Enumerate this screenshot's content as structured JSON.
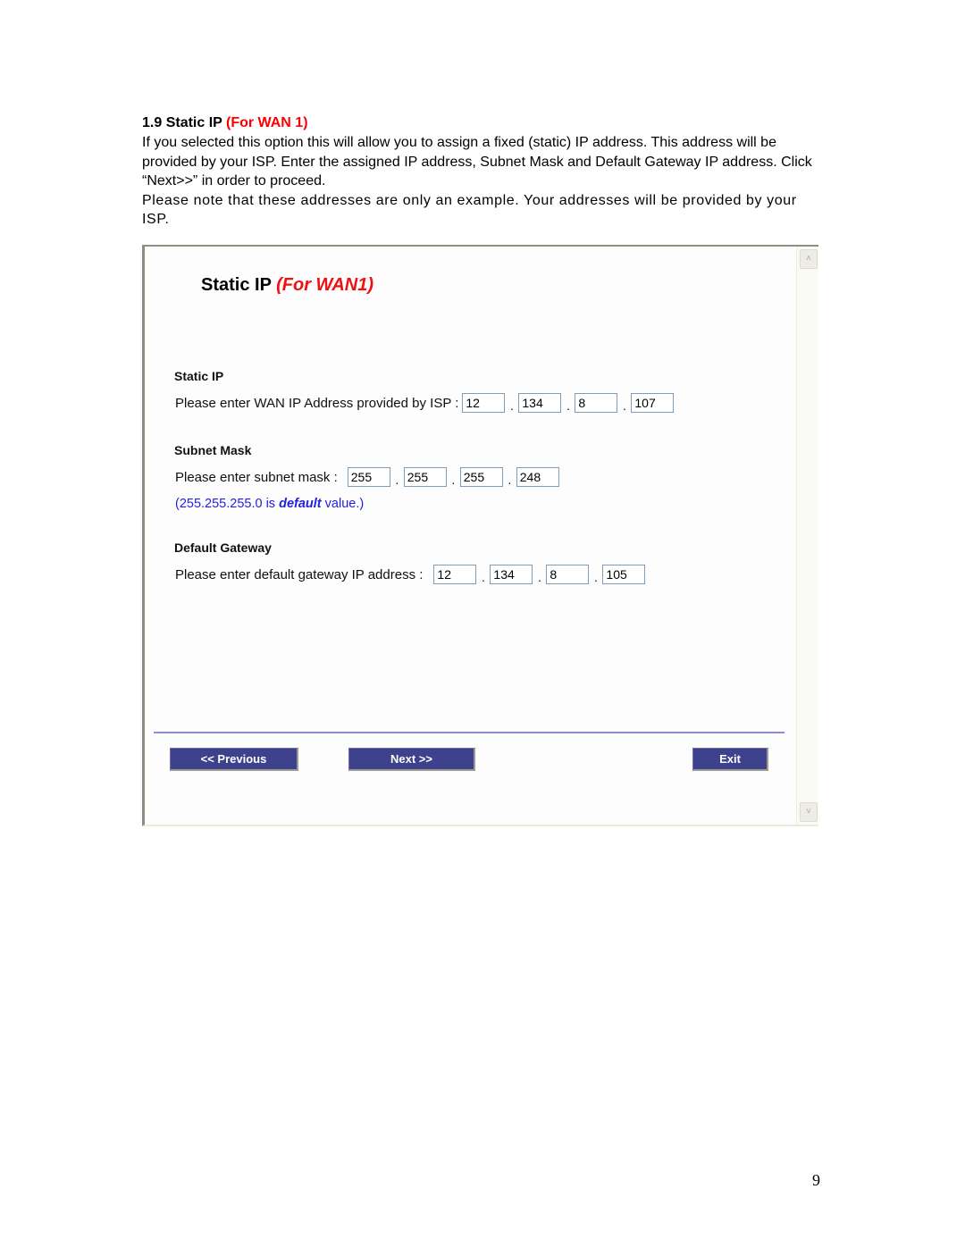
{
  "doc": {
    "heading_prefix": "1.9 Static IP ",
    "heading_highlight": "(For WAN 1)",
    "paragraph_1": "If you selected this option this will allow you to assign a fixed (static) IP address. This address will be provided by your ISP. Enter the assigned IP address, Subnet Mask and Default Gateway IP address. Click “Next>>” in order to proceed.",
    "paragraph_2": "Please note that these addresses are only an example. Your addresses will be provided by your ISP.",
    "page_number": "9"
  },
  "screenshot": {
    "title_prefix": "Static IP ",
    "title_highlight": "(For WAN1)",
    "static_ip": {
      "label": "Static IP",
      "prompt": "Please enter WAN IP Address provided by ISP :",
      "octets": [
        "12",
        "134",
        "8",
        "107"
      ]
    },
    "subnet_mask": {
      "label": "Subnet Mask",
      "prompt": "Please enter subnet mask :",
      "octets": [
        "255",
        "255",
        "255",
        "248"
      ],
      "hint_prefix": "(255.255.255.0 is ",
      "hint_emphasis": "default",
      "hint_suffix": " value.)"
    },
    "default_gateway": {
      "label": "Default Gateway",
      "prompt": "Please enter default gateway IP address :",
      "octets": [
        "12",
        "134",
        "8",
        "105"
      ]
    },
    "buttons": {
      "previous": "<< Previous",
      "next": "Next >>",
      "exit": "Exit"
    },
    "scrollbar": {
      "up_icon": "˄",
      "down_icon": "˅"
    }
  }
}
